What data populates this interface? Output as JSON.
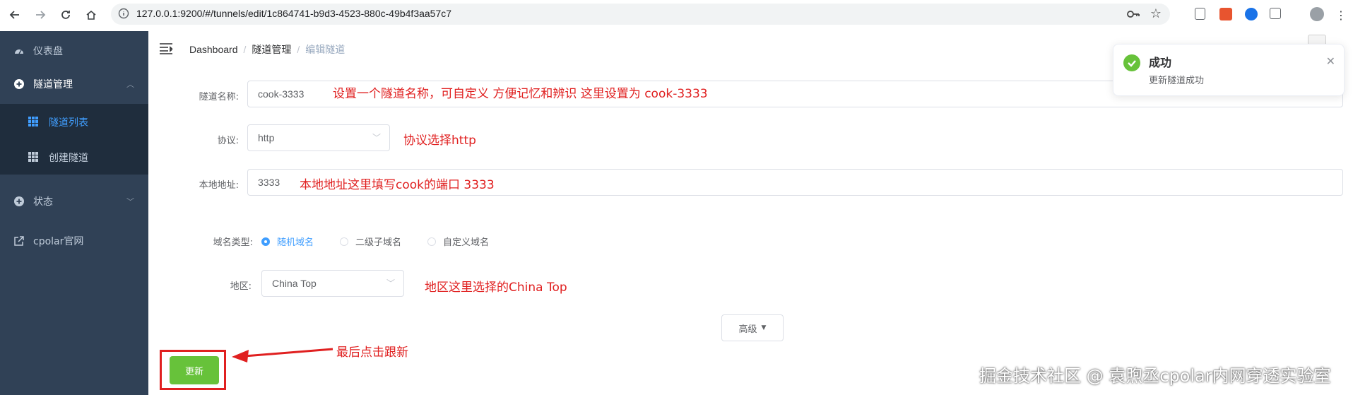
{
  "browser": {
    "url": "127.0.0.1:9200/#/tunnels/edit/1c864741-b9d3-4523-880c-49b4f3aa57c7"
  },
  "sidebar": {
    "items": [
      {
        "label": "仪表盘"
      },
      {
        "label": "隧道管理"
      },
      {
        "label": "隧道列表"
      },
      {
        "label": "创建隧道"
      },
      {
        "label": "状态"
      },
      {
        "label": "cpolar官网"
      }
    ]
  },
  "breadcrumb": {
    "items": [
      "Dashboard",
      "隧道管理",
      "编辑隧道"
    ]
  },
  "form": {
    "name_label": "隧道名称:",
    "name_value": "cook-3333",
    "protocol_label": "协议:",
    "protocol_value": "http",
    "local_label": "本地地址:",
    "local_value": "3333",
    "domain_label": "域名类型:",
    "domain_options": [
      "随机域名",
      "二级子域名",
      "自定义域名"
    ],
    "region_label": "地区:",
    "region_value": "China Top",
    "advanced_label": "高级",
    "update_label": "更新"
  },
  "annotations": {
    "name_note": "设置一个隧道名称，可自定义 方便记忆和辨识 这里设置为 cook-3333",
    "protocol_note": "协议选择http",
    "local_note": "本地地址这里填写cook的端口  3333",
    "region_note": "地区这里选择的China Top",
    "update_note": "最后点击跟新"
  },
  "toast": {
    "title": "成功",
    "message": "更新隧道成功"
  },
  "watermark": "掘金技术社区 @ 袁煦丞cpolar内网穿透实验室",
  "colors": {
    "sidebar_bg": "#304156",
    "submenu_bg": "#1f2d3d",
    "active": "#409eff",
    "success": "#67c23a",
    "annotation": "#e02020"
  }
}
